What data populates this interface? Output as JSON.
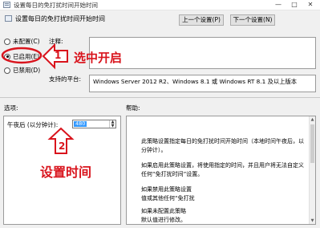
{
  "window": {
    "title": "设置每日的免打扰时间开始时间"
  },
  "header": {
    "policy_title": "设置每日的免打扰时间开始时间",
    "prev_button": "上一个设置(P)",
    "next_button": "下一个设置(N)"
  },
  "state": {
    "radios": [
      {
        "label": "未配置(C)",
        "checked": false
      },
      {
        "label": "已启用(E)",
        "checked": true
      },
      {
        "label": "已禁用(D)",
        "checked": false
      }
    ],
    "comment_label": "注释:",
    "platform_label": "支持的平台:",
    "platform_value": "Windows Server 2012 R2、Windows 8.1 或 Windows RT 8.1 及以上版本"
  },
  "options": {
    "section_label": "选项:",
    "field_label": "午夜后 (以分钟计):",
    "field_value": "480"
  },
  "help": {
    "section_label": "帮助:",
    "lines": [
      "此策略设置指定每日的免打扰时间开始时间（本地时间午夜后，以",
      "分钟计）。",
      "如果启用此策略设置，将使用指定的时间，并且用户将无法自定义",
      "任何“免打扰时间”设置。",
      "如果禁用此策略设置",
      "值或其他任何“免打扰",
      "如果未配置此策略",
      "默认值进行修改。"
    ]
  },
  "annotations": {
    "step1_number": "1",
    "step1_text": "选中开启",
    "step2_number": "2",
    "step2_text": "设置时间",
    "color": "#d9141d"
  }
}
